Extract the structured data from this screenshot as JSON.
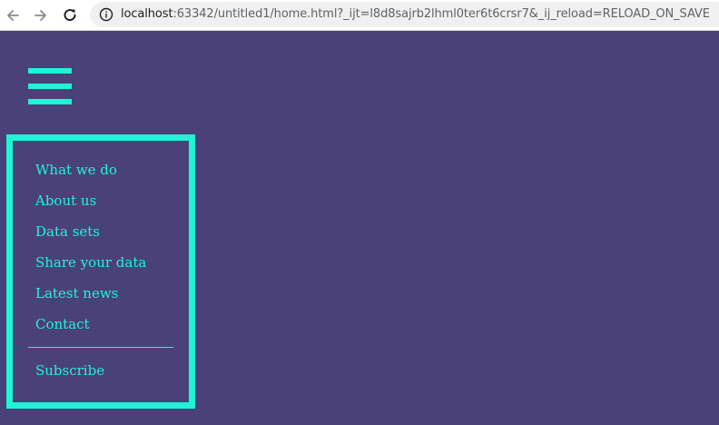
{
  "browser": {
    "url_host": "localhost",
    "url_rest": ":63342/untitled1/home.html?_ijt=l8d8sajrb2lhml0ter6t6crsr7&_ij_reload=RELOAD_ON_SAVE",
    "icons": [
      "arrow-back-icon",
      "arrow-forward-icon",
      "reload-icon",
      "info-icon"
    ]
  },
  "menu": {
    "items": [
      {
        "label": "What we do"
      },
      {
        "label": "About us"
      },
      {
        "label": "Data sets"
      },
      {
        "label": "Share your data"
      },
      {
        "label": "Latest news"
      },
      {
        "label": "Contact"
      }
    ],
    "subscribe_label": "Subscribe"
  },
  "colors": {
    "background": "#4a4179",
    "accent": "#1ef5d6"
  }
}
